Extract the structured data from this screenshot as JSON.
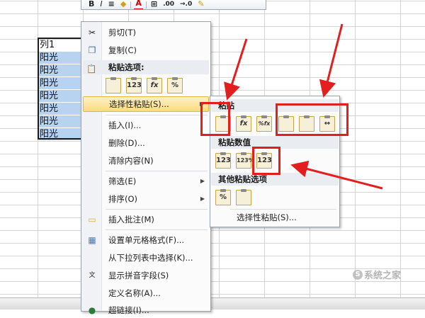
{
  "sheet": {
    "header_cell": "列1",
    "cells": [
      "阳光",
      "阳光",
      "阳光",
      "阳光",
      "阳光",
      "阳光",
      "阳光"
    ]
  },
  "mini_toolbar": {
    "bold": "B",
    "italic": "I",
    "font_color_letter": "A",
    "decimal_increase": ".00",
    "decimal_decrease": "→.0"
  },
  "context_menu": {
    "cut": "剪切(T)",
    "copy": "复制(C)",
    "paste_options_header": "粘贴选项:",
    "paste_option_buttons": [
      "",
      "123",
      "fx",
      "%"
    ],
    "paste_special": "选择性粘贴(S)...",
    "insert": "插入(I)...",
    "delete": "删除(D)...",
    "clear_contents": "清除内容(N)",
    "filter": "筛选(E)",
    "sort": "排序(O)",
    "insert_comment": "插入批注(M)",
    "format_cells": "设置单元格格式(F)...",
    "pick_from_list": "从下拉列表中选择(K)...",
    "show_phonetic": "显示拼音字段(S)",
    "define_name": "定义名称(A)...",
    "hyperlink": "超链接(I)..."
  },
  "submenu": {
    "paste_header": "粘贴",
    "paste_buttons": [
      "",
      "fx",
      "%fx",
      "",
      "",
      "↔"
    ],
    "paste_values_header": "粘贴数值",
    "values_buttons": [
      "123",
      "123%",
      "123"
    ],
    "other_paste_header": "其他粘贴选项",
    "other_buttons": [
      "%",
      ""
    ],
    "paste_special": "选择性粘贴(S)..."
  },
  "watermark": {
    "logo_letter": "S",
    "text": "系统之家"
  },
  "colors": {
    "annotation_red": "#e21e1e",
    "selection_blue": "#b8d3ef",
    "menu_highlight": "#fbdb80"
  }
}
